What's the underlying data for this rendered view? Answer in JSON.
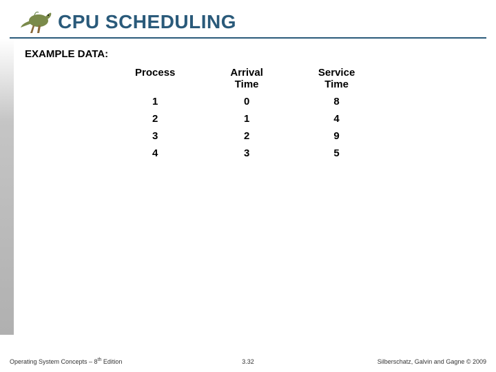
{
  "title": "CPU SCHEDULING",
  "example_label": "EXAMPLE DATA:",
  "table": {
    "headers": {
      "process": "Process",
      "arrival1": "Arrival",
      "arrival2": "Time",
      "service1": "Service",
      "service2": "Time"
    },
    "rows": [
      {
        "process": "1",
        "arrival": "0",
        "service": "8"
      },
      {
        "process": "2",
        "arrival": "1",
        "service": "4"
      },
      {
        "process": "3",
        "arrival": "2",
        "service": "9"
      },
      {
        "process": "4",
        "arrival": "3",
        "service": "5"
      }
    ]
  },
  "footer": {
    "left_a": "Operating System Concepts – 8",
    "left_sup": "th",
    "left_b": " Edition",
    "center": "3.32",
    "right": "Silberschatz, Galvin and Gagne © 2009"
  },
  "chart_data": {
    "type": "table",
    "title": "CPU Scheduling Example Data",
    "columns": [
      "Process",
      "Arrival Time",
      "Service Time"
    ],
    "rows": [
      [
        1,
        0,
        8
      ],
      [
        2,
        1,
        4
      ],
      [
        3,
        2,
        9
      ],
      [
        4,
        3,
        5
      ]
    ]
  }
}
